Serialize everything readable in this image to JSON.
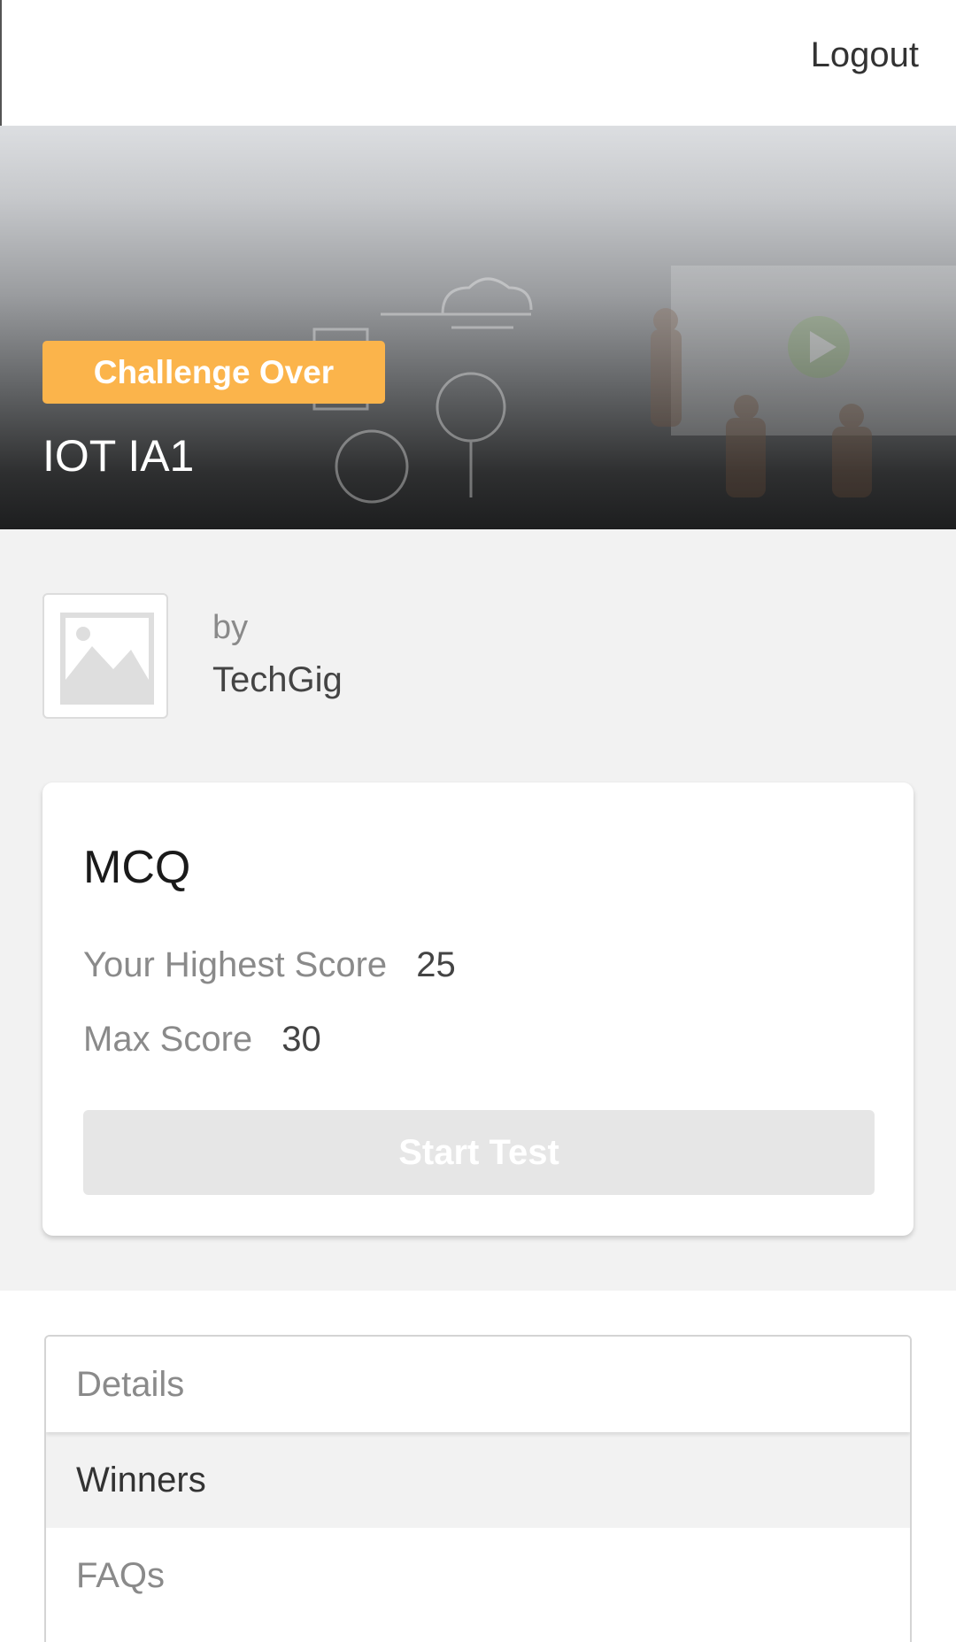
{
  "header": {
    "logout_label": "Logout"
  },
  "banner": {
    "status_badge": "Challenge Over",
    "title": "IOT IA1",
    "badge_color": "#fbb44b"
  },
  "organizer": {
    "by_label": "by",
    "name": "TechGig",
    "logo_icon": "image-placeholder-icon"
  },
  "test_card": {
    "title": "MCQ",
    "highest_score_label": "Your Highest Score",
    "highest_score_value": "25",
    "max_score_label": "Max Score",
    "max_score_value": "30",
    "start_button_label": "Start Test"
  },
  "tabs": [
    {
      "label": "Details"
    },
    {
      "label": "Winners"
    },
    {
      "label": "FAQs"
    }
  ]
}
